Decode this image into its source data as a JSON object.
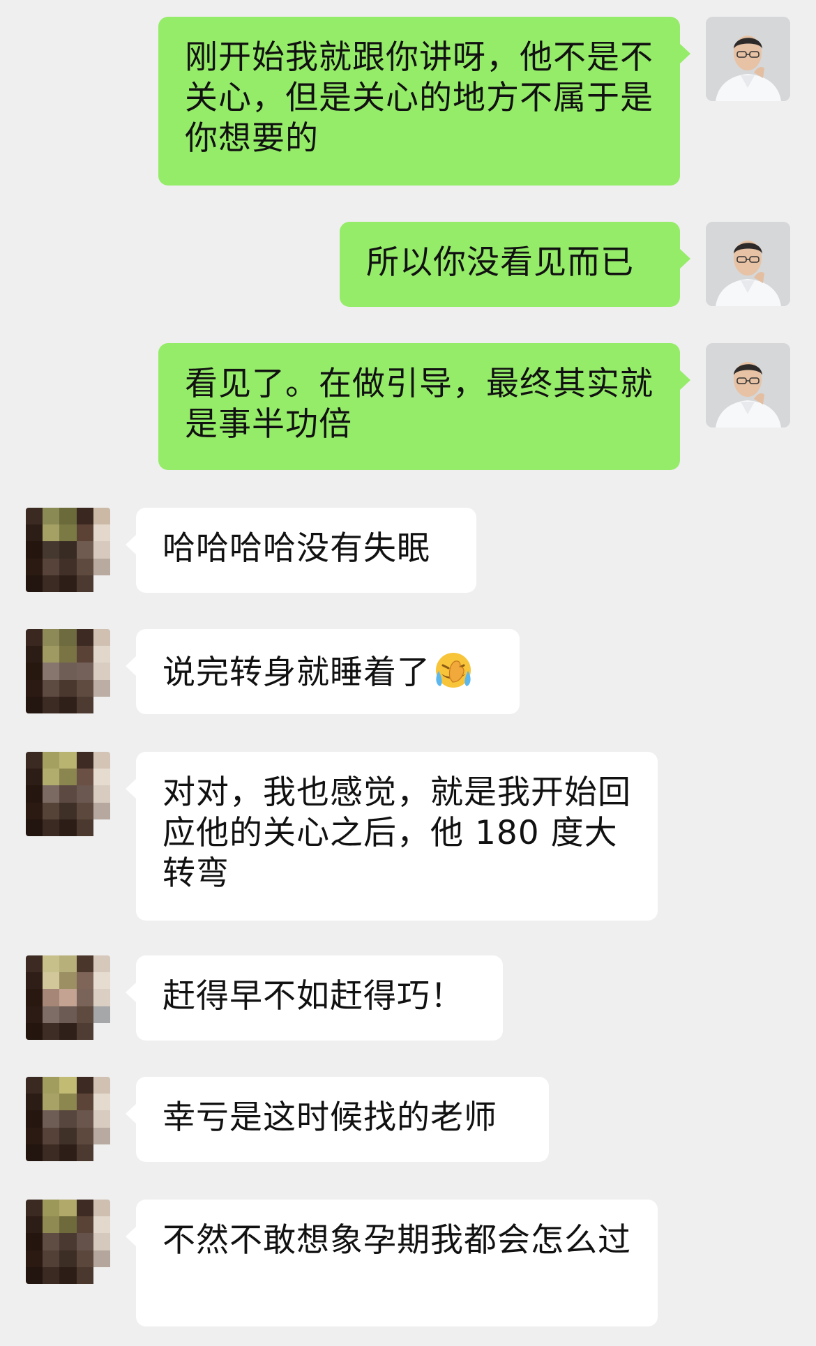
{
  "messages": [
    {
      "side": "me",
      "text": "刚开始我就跟你讲呀，他不是不关心，但是关心的地方不属于是你想要的"
    },
    {
      "side": "me",
      "text": "所以你没看见而已"
    },
    {
      "side": "me",
      "text": "看见了。在做引导，最终其实就是事半功倍"
    },
    {
      "side": "other",
      "text": "哈哈哈哈没有失眠"
    },
    {
      "side": "other",
      "text": "说完转身就睡着了"
    },
    {
      "side": "other",
      "text": "对对，我也感觉，就是我开始回应他的关心之后，他 180 度大转弯"
    },
    {
      "side": "other",
      "text": "赶得早不如赶得巧！"
    },
    {
      "side": "other",
      "text": "幸亏是这时候找的老师"
    },
    {
      "side": "other",
      "text": "不然不敢想象孕期我都会怎么过"
    }
  ],
  "colors": {
    "background": "#efefef",
    "bubble_me": "#95ec69",
    "bubble_other": "#ffffff"
  },
  "icons": {
    "reaction_emoji": "face-palm-tears-emoji-icon"
  }
}
